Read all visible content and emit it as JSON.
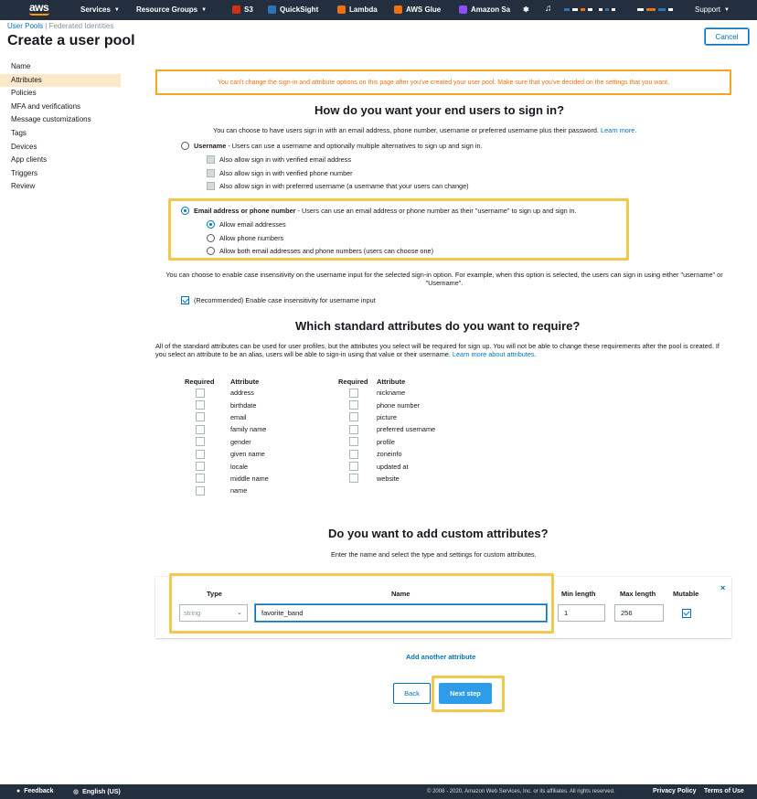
{
  "topnav": {
    "logo": "aws",
    "services": "Services",
    "resource_groups": "Resource Groups",
    "items": [
      {
        "label": "S3",
        "color": "#d13212"
      },
      {
        "label": "QuickSight",
        "color": "#2e73b8"
      },
      {
        "label": "Lambda",
        "color": "#ec7211"
      },
      {
        "label": "AWS Glue",
        "color": "#ec7211"
      },
      {
        "label": "Amazon Sa",
        "color": "#8c4fff"
      }
    ],
    "support": "Support"
  },
  "breadcrumb": {
    "user_pools": "User Pools",
    "federated": "Federated Identities"
  },
  "page_title": "Create a user pool",
  "cancel_label": "Cancel",
  "sidebar": {
    "items": [
      {
        "label": "Name",
        "active": false
      },
      {
        "label": "Attributes",
        "active": true
      },
      {
        "label": "Policies",
        "active": false
      },
      {
        "label": "MFA and verifications",
        "active": false
      },
      {
        "label": "Message customizations",
        "active": false
      },
      {
        "label": "Tags",
        "active": false
      },
      {
        "label": "Devices",
        "active": false
      },
      {
        "label": "App clients",
        "active": false
      },
      {
        "label": "Triggers",
        "active": false
      },
      {
        "label": "Review",
        "active": false
      }
    ]
  },
  "warning": "You can't change the sign-in and attribute options on this page after you've created your user pool. Make sure that you've decided on the settings that you want.",
  "signin": {
    "heading": "How do you want your end users to sign in?",
    "intro": "You can choose to have users sign in with an email address, phone number, username or preferred username plus their password.",
    "learn_more": "Learn more.",
    "username_title": "Username",
    "username_desc": " - Users can use a username and optionally multiple alternatives to sign up and sign in.",
    "username_opts": [
      "Also allow sign in with verified email address",
      "Also allow sign in with verified phone number",
      "Also allow sign in with preferred username (a username that your users can change)"
    ],
    "email_title": "Email address or phone number",
    "email_desc": " - Users can use an email address or phone number as their \"username\" to sign up and sign in.",
    "email_opts": [
      "Allow email addresses",
      "Allow phone numbers",
      "Allow both email addresses and phone numbers (users can choose one)"
    ],
    "case_text": "You can choose to enable case insensitivity on the username input for the selected sign-in option. For example, when this option is selected, the users can sign in using either \"username\" or \"Username\".",
    "case_checkbox": "(Recommended) Enable case insensitivity for username input"
  },
  "attributes": {
    "heading": "Which standard attributes do you want to require?",
    "intro": "All of the standard attributes can be used for user profiles, but the attributes you select will be required for sign up. You will not be able to change these requirements after the pool is created. If you select an attribute to be an alias, users will be able to sign-in using that value or their username.",
    "learn_more": "Learn more about attributes.",
    "col_required": "Required",
    "col_attribute": "Attribute",
    "left": [
      "address",
      "birthdate",
      "email",
      "family name",
      "gender",
      "given name",
      "locale",
      "middle name",
      "name"
    ],
    "right": [
      "nickname",
      "phone number",
      "picture",
      "preferred username",
      "profile",
      "zoneinfo",
      "updated at",
      "website"
    ]
  },
  "custom": {
    "heading": "Do you want to add custom attributes?",
    "intro": "Enter the name and select the type and settings for custom attributes.",
    "col_type": "Type",
    "col_name": "Name",
    "col_min": "Min length",
    "col_max": "Max length",
    "col_mutable": "Mutable",
    "type_value": "string",
    "name_value": "favorite_band",
    "min_value": "1",
    "max_value": "256",
    "close": "×",
    "add_another": "Add another attribute"
  },
  "buttons": {
    "back": "Back",
    "next": "Next step"
  },
  "footer": {
    "feedback": "Feedback",
    "language": "English (US)",
    "copyright": "© 2008 - 2020, Amazon Web Services, Inc. or its affiliates. All rights reserved.",
    "privacy": "Privacy Policy",
    "terms": "Terms of Use"
  }
}
